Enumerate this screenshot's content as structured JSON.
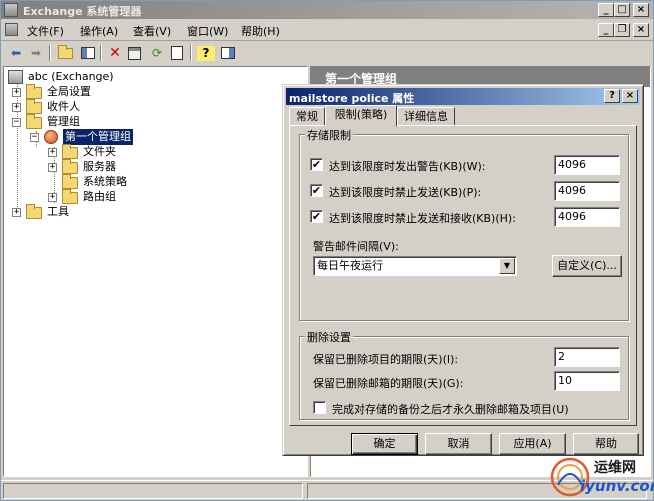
{
  "window": {
    "title": "Exchange 系统管理器",
    "controls": {
      "minimize": "_",
      "maximize": "□",
      "close": "×"
    },
    "child_controls": {
      "minimize": "_",
      "restore": "❐",
      "close": "×"
    }
  },
  "menu": [
    "文件(F)",
    "操作(A)",
    "查看(V)",
    "窗口(W)",
    "帮助(H)"
  ],
  "tree": {
    "root": "abc (Exchange)",
    "items": [
      "全局设置",
      "收件人",
      "管理组",
      "第一个管理组",
      "文件夹",
      "服务器",
      "系统策略",
      "路由组",
      "工具"
    ]
  },
  "right_pane": {
    "header": "第一个管理组"
  },
  "dialog": {
    "title": "mailstore police 属性",
    "help": "?",
    "close": "×",
    "tabs": [
      "常规",
      "限制(策略)",
      "详细信息"
    ],
    "storage": {
      "title": "存储限制",
      "rows": [
        {
          "label": "达到该限度时发出警告(KB)(W):",
          "value": "4096",
          "checked": "✔"
        },
        {
          "label": "达到该限度时禁止发送(KB)(P):",
          "value": "4096",
          "checked": "✔"
        },
        {
          "label": "达到该限度时禁止发送和接收(KB)(H):",
          "value": "4096",
          "checked": "✔"
        }
      ],
      "interval_label": "警告邮件间隔(V):",
      "interval_value": "每日午夜运行",
      "custom_button": "自定义(C)..."
    },
    "deletion": {
      "title": "删除设置",
      "items_label": "保留已删除项目的期限(天)(I):",
      "items_value": "2",
      "mailbox_label": "保留已删除邮箱的期限(天)(G):",
      "mailbox_value": "10",
      "backup_label": "完成对存储的备份之后才永久删除邮箱及项目(U)"
    },
    "buttons": {
      "ok": "确定",
      "cancel": "取消",
      "apply": "应用(A)",
      "help": "帮助"
    }
  },
  "watermark": {
    "line1": "运维网",
    "line2": "iyunv.com"
  }
}
